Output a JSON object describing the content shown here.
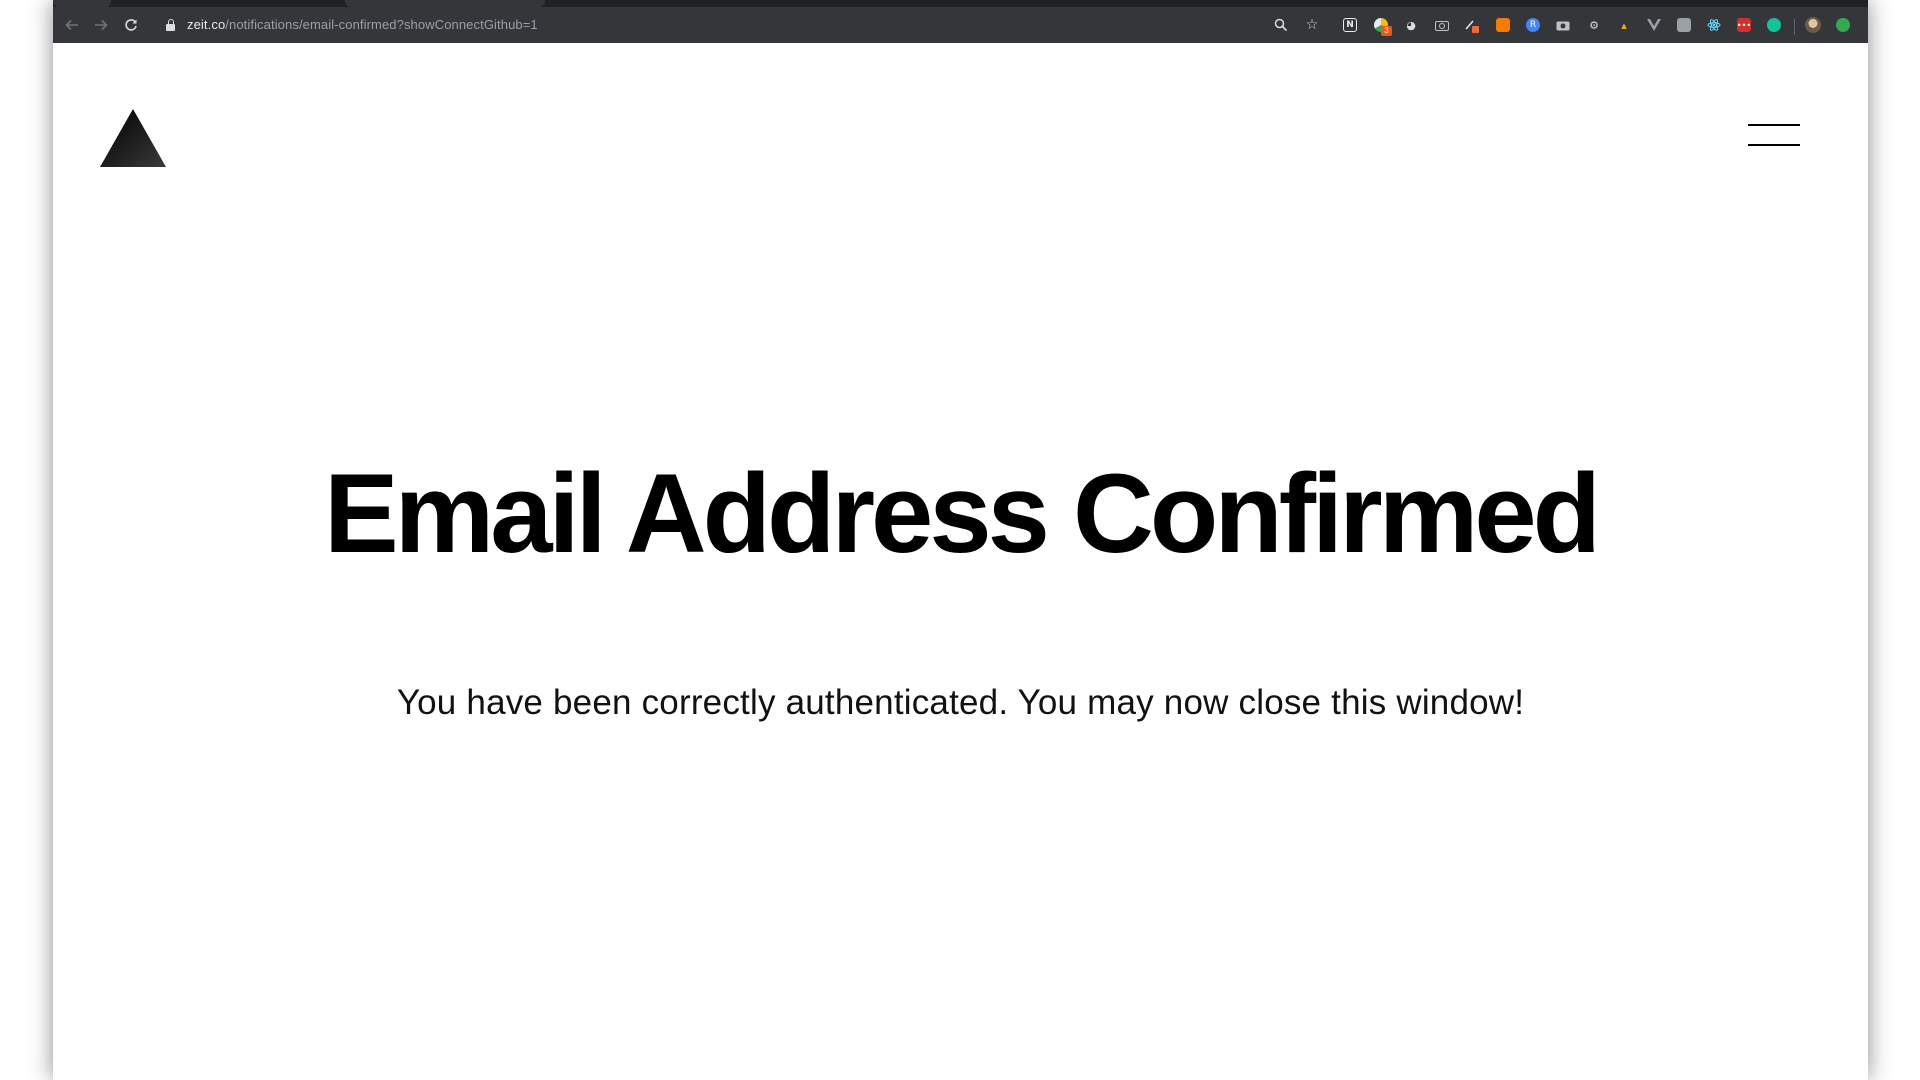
{
  "browser": {
    "url_host": "zeit.co",
    "url_path": "/notifications/email-confirmed?showConnectGithub=1",
    "nav": {
      "back_icon": "arrow-left-icon",
      "forward_icon": "arrow-right-icon",
      "reload_icon": "reload-icon"
    },
    "omnibox_icons": [
      "zoom-icon",
      "star-icon"
    ],
    "extensions": [
      {
        "name": "notion-icon",
        "color": "#e8eaed"
      },
      {
        "name": "multi-color-extension-icon",
        "color": "#fbbc05",
        "badge": "3"
      },
      {
        "name": "ghost-icon",
        "color": "#e8eaed"
      },
      {
        "name": "camera-icon",
        "color": "#bdc1c6"
      },
      {
        "name": "pen-extension-icon",
        "color": "#e8eaed"
      },
      {
        "name": "rss-icon",
        "color": "#f57c00"
      },
      {
        "name": "r-extension-icon",
        "color": "#4285f4"
      },
      {
        "name": "screenshot-icon",
        "color": "#bdc1c6"
      },
      {
        "name": "gear-icon",
        "color": "#bdc1c6"
      },
      {
        "name": "bird-icon",
        "color": "#f9ab00"
      },
      {
        "name": "vue-icon",
        "color": "#9aa0a6"
      },
      {
        "name": "image-extension-icon",
        "color": "#9aa0a6"
      },
      {
        "name": "react-icon",
        "color": "#61dafb"
      },
      {
        "name": "lastpass-icon",
        "color": "#d32f2f"
      },
      {
        "name": "grammarly-icon",
        "color": "#15c39a"
      },
      {
        "name": "profile-avatar-icon",
        "color": "#c8a27a"
      },
      {
        "name": "update-icon",
        "color": "#34a853"
      }
    ]
  },
  "header": {
    "logo_icon": "zeit-triangle-logo-icon",
    "menu_icon": "hamburger-menu-icon"
  },
  "main": {
    "title": "Email Address Confirmed",
    "message": "You have been correctly authenticated. You may now close this window!"
  }
}
